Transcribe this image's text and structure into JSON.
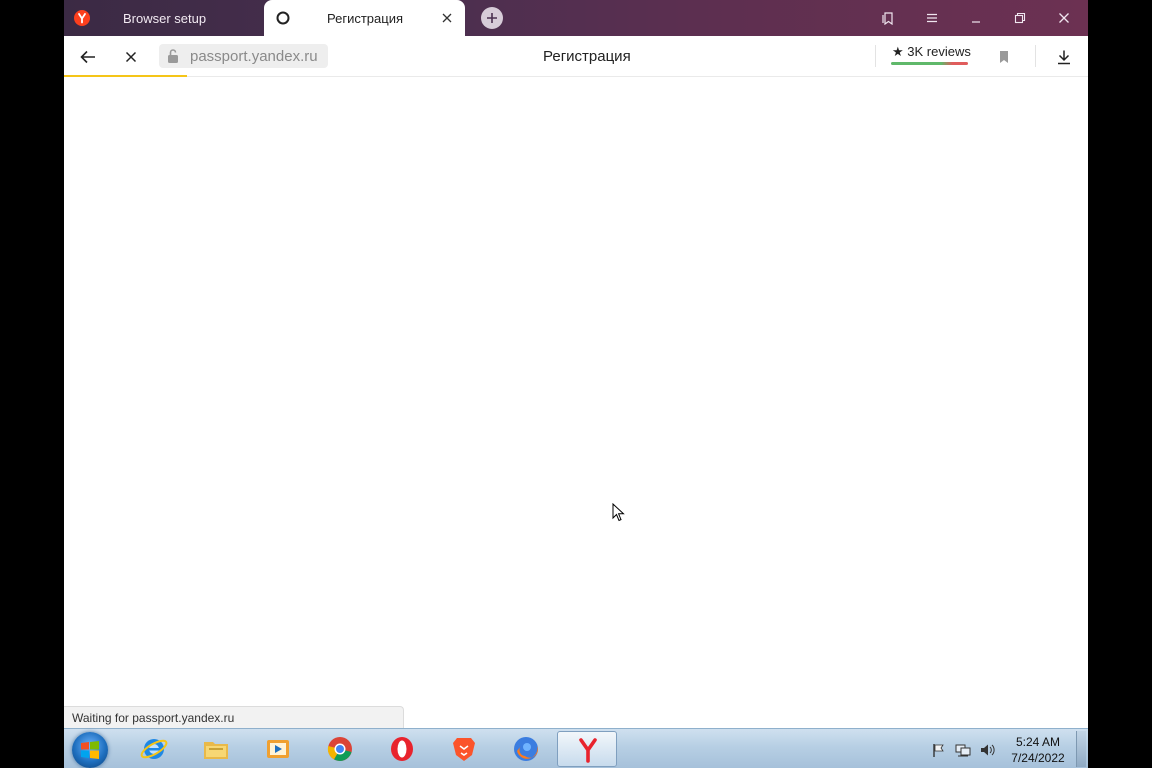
{
  "tabs": [
    {
      "title": "Browser setup",
      "active": false,
      "favicon": "yandex-icon"
    },
    {
      "title": "Регистрация",
      "active": true,
      "favicon": "loading-circle-icon"
    }
  ],
  "toolbar": {
    "url": "passport.yandex.ru",
    "page_title": "Регистрация",
    "reviews_label": "★ 3K reviews",
    "load_progress": 0.12
  },
  "status": {
    "text": "Waiting for passport.yandex.ru"
  },
  "taskbar": {
    "apps": [
      "internet-explorer",
      "file-explorer",
      "media-player",
      "chrome",
      "opera",
      "brave",
      "firefox",
      "yandex-browser"
    ],
    "active_app": "yandex-browser",
    "clock": {
      "time": "5:24 AM",
      "date": "7/24/2022"
    }
  },
  "colors": {
    "tabstrip": "#4a2f4f",
    "progress": "#f5c518",
    "yandex_red": "#e8232d"
  }
}
